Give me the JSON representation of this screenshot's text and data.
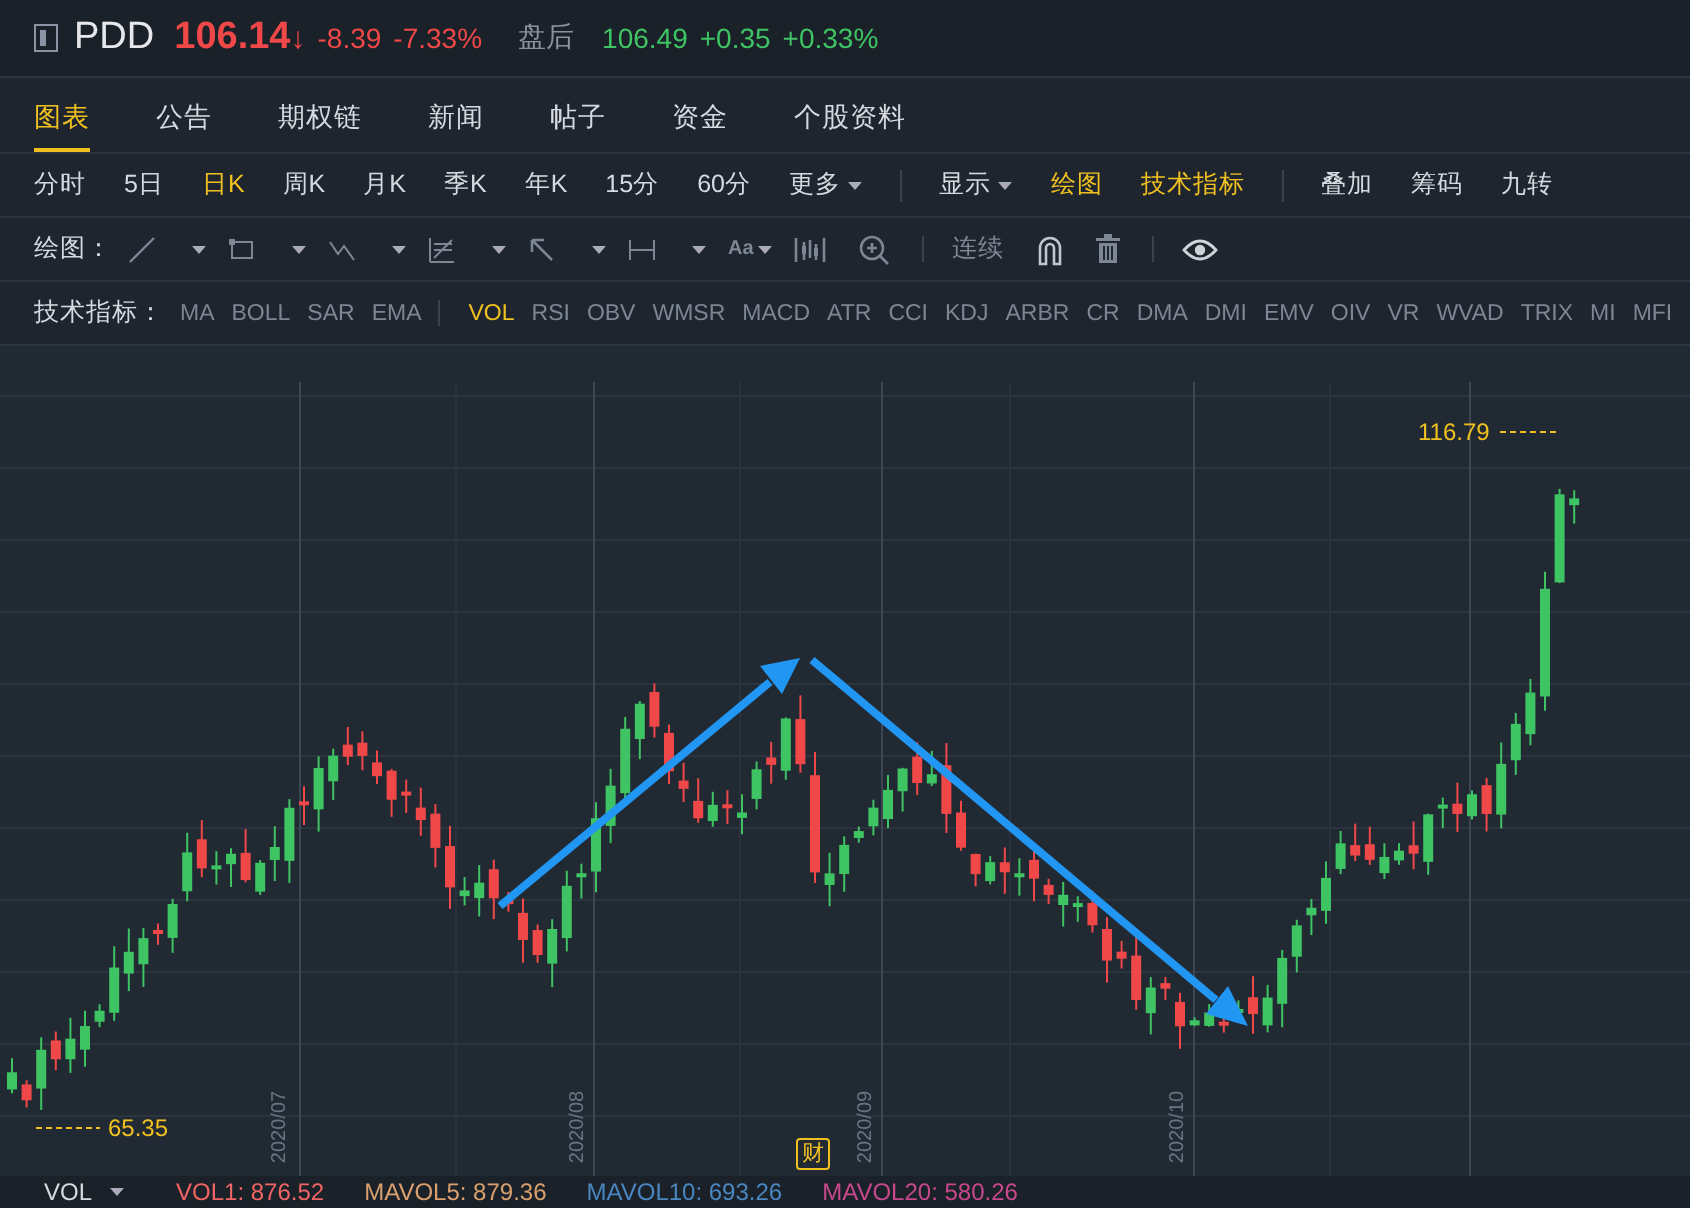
{
  "header": {
    "symbol": "PDD",
    "price": "106.14",
    "direction": "↓",
    "change": "-8.39",
    "change_pct": "-7.33%",
    "session": "盘后",
    "after_price": "106.49",
    "after_change": "+0.35",
    "after_pct": "+0.33%"
  },
  "tabs": [
    {
      "label": "图表",
      "selected": true
    },
    {
      "label": "公告",
      "selected": false
    },
    {
      "label": "期权链",
      "selected": false
    },
    {
      "label": "新闻",
      "selected": false
    },
    {
      "label": "帖子",
      "selected": false
    },
    {
      "label": "资金",
      "selected": false
    },
    {
      "label": "个股资料",
      "selected": false
    }
  ],
  "periods": [
    {
      "label": "分时",
      "selected": false
    },
    {
      "label": "5日",
      "selected": false
    },
    {
      "label": "日K",
      "selected": true
    },
    {
      "label": "周K",
      "selected": false
    },
    {
      "label": "月K",
      "selected": false
    },
    {
      "label": "季K",
      "selected": false
    },
    {
      "label": "年K",
      "selected": false
    },
    {
      "label": "15分",
      "selected": false
    },
    {
      "label": "60分",
      "selected": false
    },
    {
      "label": "更多",
      "selected": false,
      "dropdown": true
    }
  ],
  "view_options": [
    {
      "label": "显示",
      "active": false,
      "dropdown": true
    },
    {
      "label": "绘图",
      "active": true
    },
    {
      "label": "技术指标",
      "active": true
    }
  ],
  "extras": [
    {
      "label": "叠加"
    },
    {
      "label": "筹码"
    },
    {
      "label": "九转"
    }
  ],
  "draw_toolbar": {
    "label": "绘图：",
    "font_tool": "Aa",
    "continuous": "连续"
  },
  "indicators": {
    "label": "技术指标：",
    "items": [
      {
        "label": "MA",
        "selected": false
      },
      {
        "label": "BOLL",
        "selected": false
      },
      {
        "label": "SAR",
        "selected": false
      },
      {
        "label": "EMA",
        "selected": false,
        "separator_after": true
      },
      {
        "label": "VOL",
        "selected": true
      },
      {
        "label": "RSI",
        "selected": false
      },
      {
        "label": "OBV",
        "selected": false
      },
      {
        "label": "WMSR",
        "selected": false
      },
      {
        "label": "MACD",
        "selected": false
      },
      {
        "label": "ATR",
        "selected": false
      },
      {
        "label": "CCI",
        "selected": false
      },
      {
        "label": "KDJ",
        "selected": false
      },
      {
        "label": "ARBR",
        "selected": false
      },
      {
        "label": "CR",
        "selected": false
      },
      {
        "label": "DMA",
        "selected": false
      },
      {
        "label": "DMI",
        "selected": false
      },
      {
        "label": "EMV",
        "selected": false
      },
      {
        "label": "OIV",
        "selected": false
      },
      {
        "label": "VR",
        "selected": false
      },
      {
        "label": "WVAD",
        "selected": false
      },
      {
        "label": "TRIX",
        "selected": false
      },
      {
        "label": "MI",
        "selected": false
      },
      {
        "label": "MFI",
        "selected": false
      }
    ]
  },
  "chart": {
    "high_label": "116.79",
    "low_label": "65.35",
    "date_labels": [
      "2020/07",
      "2020/08",
      "2020/09",
      "2020/10"
    ],
    "event_badge": "财"
  },
  "footer": {
    "selector": "VOL",
    "values": [
      {
        "label": "VOL1: 876.52",
        "color": "#f06464"
      },
      {
        "label": "MAVOL5: 879.36",
        "color": "#d9a06e"
      },
      {
        "label": "MAVOL10: 693.26",
        "color": "#4a86c0"
      },
      {
        "label": "MAVOL20: 580.26",
        "color": "#c8488c"
      }
    ]
  }
}
